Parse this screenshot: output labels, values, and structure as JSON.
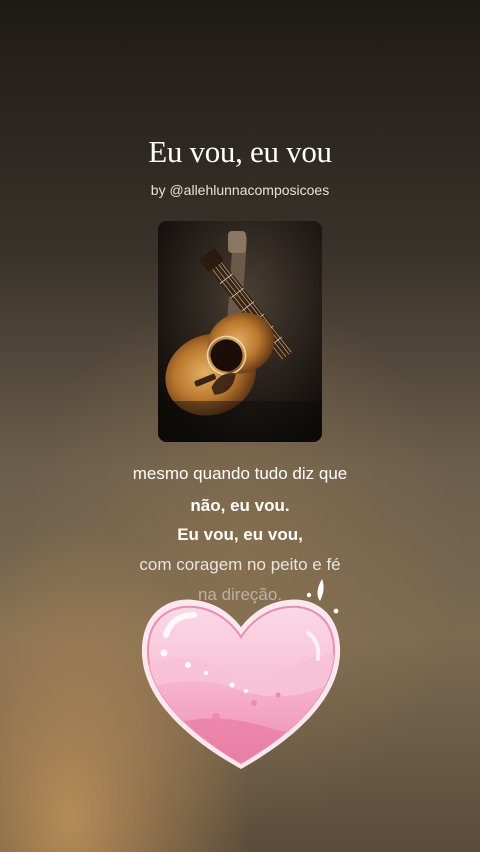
{
  "song": {
    "title": "Eu vou, eu vou",
    "author": "by @allehlunnacomposicoes"
  },
  "cover": {
    "icon": "acoustic-guitar-photo"
  },
  "lyrics": {
    "lines": [
      "mesmo quando tudo diz que",
      "não, eu vou.",
      "Eu vou, eu vou,",
      "com coragem no peito e fé",
      "na direção."
    ]
  },
  "sticker": {
    "icon": "pink-heart-sticker",
    "color": "#f4a9c4"
  }
}
